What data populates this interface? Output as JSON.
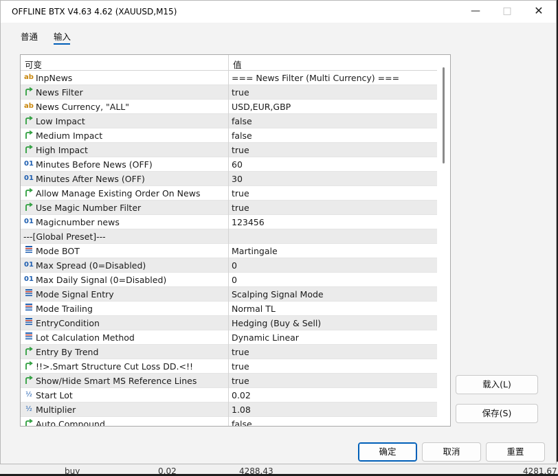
{
  "window": {
    "title": "OFFLINE BTX V4.63 4.62 (XAUUSD,M15)"
  },
  "tabs": [
    {
      "label": "普通"
    },
    {
      "label": "输入"
    }
  ],
  "grid": {
    "col_variable": "可变",
    "col_value": "值",
    "rows": [
      {
        "icon": "ab",
        "name": "InpNews",
        "value": "=== News Filter (Multi Currency) ==="
      },
      {
        "icon": "bool",
        "name": "News Filter",
        "value": "true"
      },
      {
        "icon": "ab",
        "name": "News Currency, \"ALL\"",
        "value": "USD,EUR,GBP"
      },
      {
        "icon": "bool",
        "name": "Low Impact",
        "value": "false"
      },
      {
        "icon": "bool",
        "name": "Medium Impact",
        "value": "false"
      },
      {
        "icon": "bool",
        "name": "High Impact",
        "value": "true"
      },
      {
        "icon": "num",
        "name": "Minutes Before News (OFF)",
        "value": "60"
      },
      {
        "icon": "num",
        "name": "Minutes After News (OFF)",
        "value": "30"
      },
      {
        "icon": "bool",
        "name": "Allow Manage Existing Order On News",
        "value": "true"
      },
      {
        "icon": "bool",
        "name": "Use Magic Number Filter",
        "value": "true"
      },
      {
        "icon": "num",
        "name": "Magicnumber news",
        "value": "123456"
      },
      {
        "icon": "none",
        "name": "---[Global Preset]---",
        "value": ""
      },
      {
        "icon": "list",
        "name": "Mode BOT",
        "value": "Martingale"
      },
      {
        "icon": "num",
        "name": "Max Spread (0=Disabled)",
        "value": "0"
      },
      {
        "icon": "num",
        "name": "Max Daily Signal (0=Disabled)",
        "value": "0"
      },
      {
        "icon": "list",
        "name": "Mode Signal Entry",
        "value": "Scalping Signal Mode"
      },
      {
        "icon": "list",
        "name": "Mode Trailing",
        "value": "Normal TL"
      },
      {
        "icon": "list",
        "name": "EntryCondition",
        "value": "Hedging (Buy & Sell)"
      },
      {
        "icon": "list",
        "name": "Lot Calculation Method",
        "value": "Dynamic Linear"
      },
      {
        "icon": "bool",
        "name": "Entry By Trend",
        "value": "true"
      },
      {
        "icon": "bool",
        "name": "!!>.Smart Structure Cut Loss DD.<!!",
        "value": "true"
      },
      {
        "icon": "bool",
        "name": "Show/Hide Smart MS Reference Lines",
        "value": "true"
      },
      {
        "icon": "frac",
        "name": "Start Lot",
        "value": "0.02"
      },
      {
        "icon": "frac",
        "name": "Multiplier",
        "value": "1.08"
      },
      {
        "icon": "bool",
        "name": "Auto Compound",
        "value": "false"
      }
    ]
  },
  "buttons": {
    "load": "载入(L)",
    "save": "保存(S)",
    "ok": "确定",
    "cancel": "取消",
    "reset": "重置"
  },
  "background_row": {
    "type": "buy",
    "volume": "0.02",
    "price": "4288.43",
    "current": "4281.67"
  },
  "colors": {
    "accent": "#005fb8",
    "ab_icon": "#c8860b",
    "num_icon": "#1f5fb0",
    "bool_icon": "#2e9e3e"
  }
}
